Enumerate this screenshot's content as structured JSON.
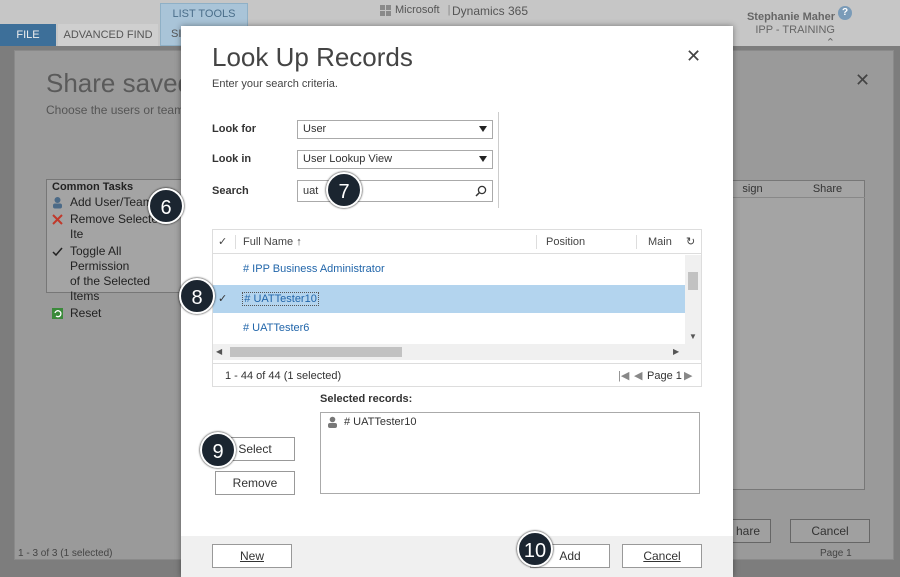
{
  "app": {
    "tab_file": "FILE",
    "tab_advanced_find": "ADVANCED FIND",
    "tab_partial": "SI",
    "list_tools": "LIST TOOLS",
    "microsoft": "Microsoft",
    "product": "Dynamics 365",
    "user_name": "Stephanie Maher",
    "org": "IPP - TRAINING",
    "help": "?"
  },
  "bg_dialog": {
    "title": "Share saved",
    "subtitle": "Choose the users or team",
    "common_tasks_title": "Common Tasks",
    "tasks": [
      "Add User/Team",
      "Remove Selected Ite",
      "Toggle All Permission",
      "of the Selected Items",
      "Reset"
    ],
    "col_assign": "sign",
    "col_share": "Share",
    "share_btn": "hare",
    "cancel_btn": "Cancel",
    "status": "1 - 3 of 3 (1 selected)",
    "page": "Page 1"
  },
  "dialog": {
    "title": "Look Up Records",
    "subtitle": "Enter your search criteria.",
    "look_for_label": "Look for",
    "look_for_value": "User",
    "look_in_label": "Look in",
    "look_in_value": "User Lookup View",
    "search_label": "Search",
    "search_value": "uat",
    "grid": {
      "col_fullname": "Full Name",
      "col_position": "Position",
      "col_main": "Main",
      "rows": [
        "# IPP Business Administrator",
        "# UATTester10",
        "# UATTester6"
      ],
      "footer": "1 - 44 of 44 (1 selected)",
      "page": "Page 1"
    },
    "selected_records_label": "Selected records:",
    "selected_records": [
      "# UATTester10"
    ],
    "select_btn": "Select",
    "remove_btn": "Remove",
    "new_btn": "New",
    "add_btn": "Add",
    "cancel_btn": "Cancel"
  },
  "callouts": [
    "6",
    "7",
    "8",
    "9",
    "10"
  ],
  "colors": {
    "selected_row": "#b3d4ee",
    "link": "#2266aa",
    "badge": "#1b2530"
  }
}
